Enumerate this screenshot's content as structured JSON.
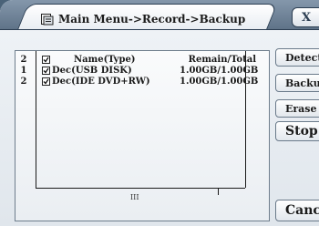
{
  "window": {
    "title": "Main Menu->Record->Backup",
    "close_glyph": "X"
  },
  "list": {
    "header": {
      "count": "2",
      "checked": true,
      "name_label": "Name(Type)",
      "remain_label": "Remain/Total"
    },
    "rows": [
      {
        "num": "1",
        "checked": true,
        "name": "Dec(USB DISK)",
        "remain": "1.00GB/1.00GB"
      },
      {
        "num": "2",
        "checked": true,
        "name": "Dec(IDE DVD+RW)",
        "remain": "1.00GB/1.00GB"
      }
    ],
    "scroll_thumb": "III"
  },
  "buttons": {
    "detect": "Detect",
    "backup": "Backup",
    "erase": "Erase",
    "stop": "Stop",
    "cancel": "Cancel"
  },
  "icons": {
    "title_icon": "drive-icon"
  }
}
